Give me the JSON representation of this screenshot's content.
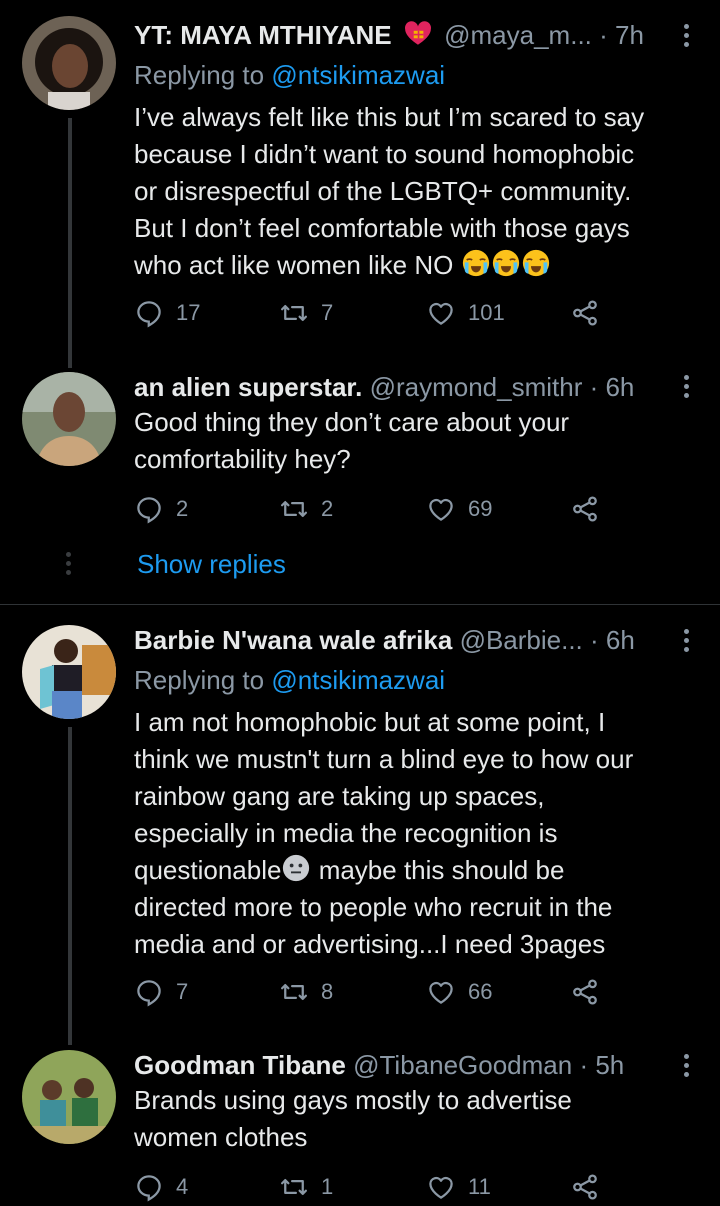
{
  "tweets": [
    {
      "name": "YT: MAYA MTHIYANE",
      "handle": "@maya_m...",
      "time": "· 7h",
      "replying_prefix": "Replying to ",
      "replying_to": "@ntsikimazwai",
      "lines": [
        "I’ve always felt like this but I’m scared to say",
        "because I didn’t want to sound homophobic",
        "or disrespectful of the LGBTQ+ community.",
        "But I don’t feel comfortable with those gays",
        "who act like women like NO"
      ],
      "emoji_name": "loudly-crying-face-icon",
      "replies": "17",
      "retweets": "7",
      "likes": "101"
    },
    {
      "name": "an alien superstar.",
      "handle": "@raymond_smithr",
      "time": "· 6h",
      "lines": [
        "Good thing they don’t care about your",
        "comfortability hey?"
      ],
      "replies": "2",
      "retweets": "2",
      "likes": "69"
    },
    {
      "name": "Barbie N'wana wale afrika",
      "handle": "@Barbie...",
      "time": "· 6h",
      "replying_prefix": "Replying to ",
      "replying_to": "@ntsikimazwai",
      "lines": [
        "I am not homophobic but at some point, I",
        "think we mustn't turn a blind eye to how our",
        "rainbow gang are taking up spaces,",
        "especially in media the recognition is",
        "questionable",
        "directed more to people who recruit in the",
        "media and or advertising...I need 3pages"
      ],
      "line5_suffix": " maybe this should be",
      "replies": "7",
      "retweets": "8",
      "likes": "66"
    },
    {
      "name": "Goodman Tibane",
      "handle": "@TibaneGoodman",
      "time": "· 5h",
      "lines": [
        "Brands using gays mostly to advertise",
        "women clothes"
      ],
      "replies": "4",
      "retweets": "1",
      "likes": "11"
    }
  ],
  "show_replies": "Show replies",
  "colors": {
    "background": "#000000",
    "text": "#e7e9ea",
    "muted": "#8b98a5",
    "link": "#1d9bf0"
  }
}
